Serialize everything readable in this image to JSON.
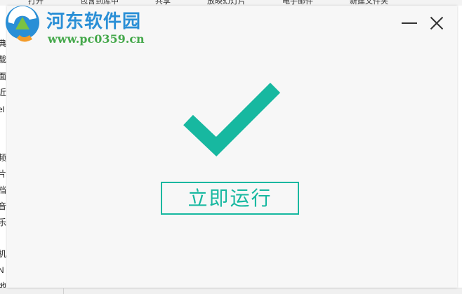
{
  "background": {
    "menu_items": [
      "打开",
      "包含到库中",
      "共享",
      "放映幻灯片",
      "电子邮件",
      "新建文件夹"
    ],
    "sidebar_chars": [
      "典",
      "载",
      "面",
      "近",
      "el",
      "频",
      "片",
      "档",
      "音",
      "乐",
      "机",
      "N",
      "地"
    ]
  },
  "dialog": {
    "run_button_label": "立即运行",
    "accent_color": "#17b8a0"
  },
  "watermark": {
    "site_name": "河东软件园",
    "url": "www.pc0359.cn"
  }
}
